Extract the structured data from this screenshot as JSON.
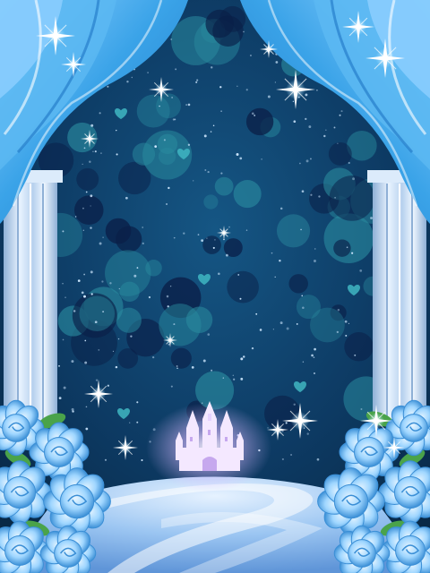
{
  "scene": {
    "kind": "decorative-background",
    "palette": {
      "night_sky": "#0d3a63",
      "night_sky_deep": "#082947",
      "bokeh_teal": "#2a8ca0",
      "bokeh_dark": "#0a1f48",
      "curtain": "#3aa3e8",
      "curtain_light": "#8fd0ff",
      "curtain_dark": "#1e74c4",
      "pillar": "#cfe3f6",
      "pillar_shadow": "#8fb0d6",
      "rose": "#9fd6ff",
      "rose_dark": "#3b8fd6",
      "leaf": "#4aa34a",
      "castle": "#f4e8ff",
      "castle_glow": "#d9b8ff",
      "floor": "#9cc6f2",
      "sparkle": "#ffffff"
    },
    "elements": [
      "curtain-left",
      "curtain-right",
      "pillar-left",
      "pillar-right",
      "castle",
      "roses-left",
      "roses-right",
      "sparkles",
      "bokeh-dots",
      "hearts",
      "path"
    ]
  }
}
